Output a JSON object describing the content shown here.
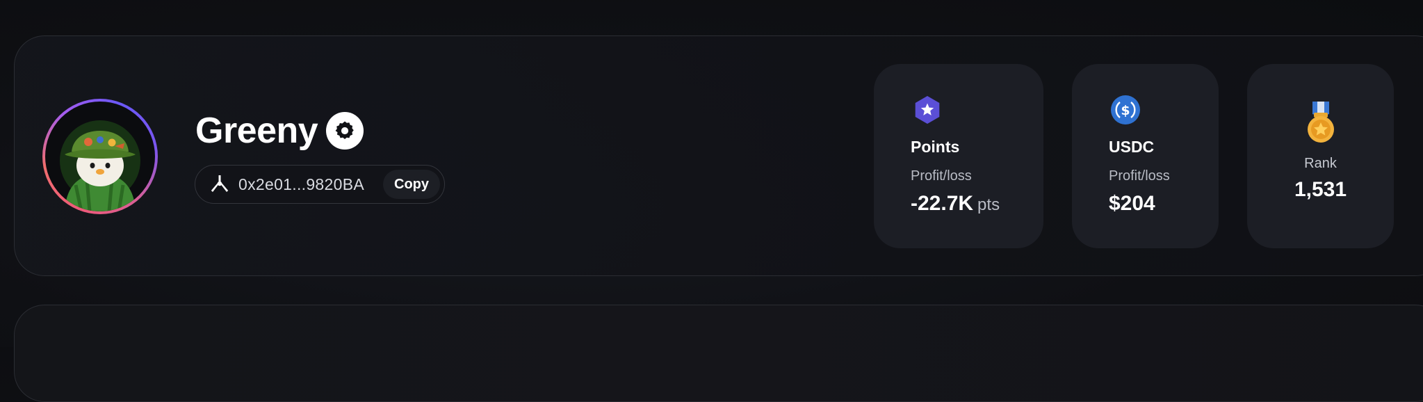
{
  "profile": {
    "username": "Greeny",
    "wallet_address": "0x2e01...9820BA",
    "copy_label": "Copy",
    "avatar_icon": "penguin-bucket-hat-avatar",
    "settings_icon": "gear-icon",
    "wallet_icon": "tri-spoke-wallet-icon"
  },
  "stats": {
    "points": {
      "icon": "hexagon-star-icon",
      "title": "Points",
      "subtitle": "Profit/loss",
      "value": "-22.7K",
      "unit": "pts",
      "accent": "#5b4fd6"
    },
    "usdc": {
      "icon": "usdc-coin-icon",
      "title": "USDC",
      "subtitle": "Profit/loss",
      "value": "$204",
      "accent": "#2f72d2"
    },
    "rank": {
      "icon": "gold-medal-icon",
      "label": "Rank",
      "value": "1,531",
      "accent": "#f3b33d"
    }
  },
  "colors": {
    "background": "#0f1014",
    "card_border": "#2b2d33",
    "stat_card": "#1c1e25",
    "avatar_ring_start": "#ef5a7a",
    "avatar_ring_end": "#6a58f5"
  }
}
